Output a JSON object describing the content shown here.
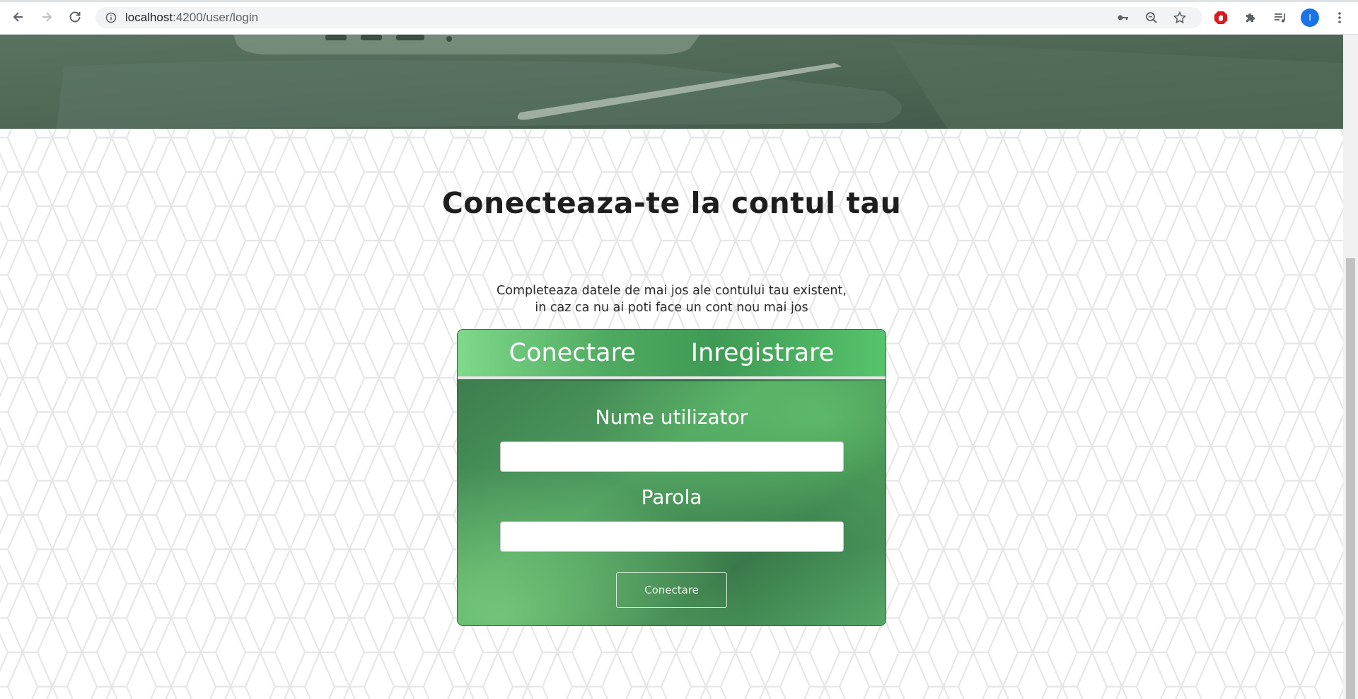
{
  "browser": {
    "url_host": "localhost",
    "url_path": ":4200/user/login",
    "profile_initial": "I",
    "icons": {
      "back": "back-arrow-icon",
      "forward": "forward-arrow-icon",
      "reload": "reload-icon",
      "site_info": "info-icon",
      "password": "key-icon",
      "zoom": "zoom-out-icon",
      "bookmark": "star-icon",
      "adblock": "adblock-icon",
      "extensions": "puzzle-icon",
      "media": "media-queue-icon",
      "menu": "kebab-menu-icon"
    }
  },
  "page": {
    "heading": "Conecteaza-te la contul tau",
    "subtext_line1": "Completeaza datele de mai jos ale contului tau existent,",
    "subtext_line2": "in caz ca nu ai poti face un cont nou mai jos"
  },
  "card": {
    "tabs": [
      {
        "label": "Conectare"
      },
      {
        "label": "Inregistrare"
      }
    ],
    "username_label": "Nume utilizator",
    "username_value": "",
    "password_label": "Parola",
    "password_value": "",
    "submit_label": "Conectare"
  },
  "colors": {
    "accent_green": "#4faa61",
    "heading_text": "#1e1e1e"
  }
}
